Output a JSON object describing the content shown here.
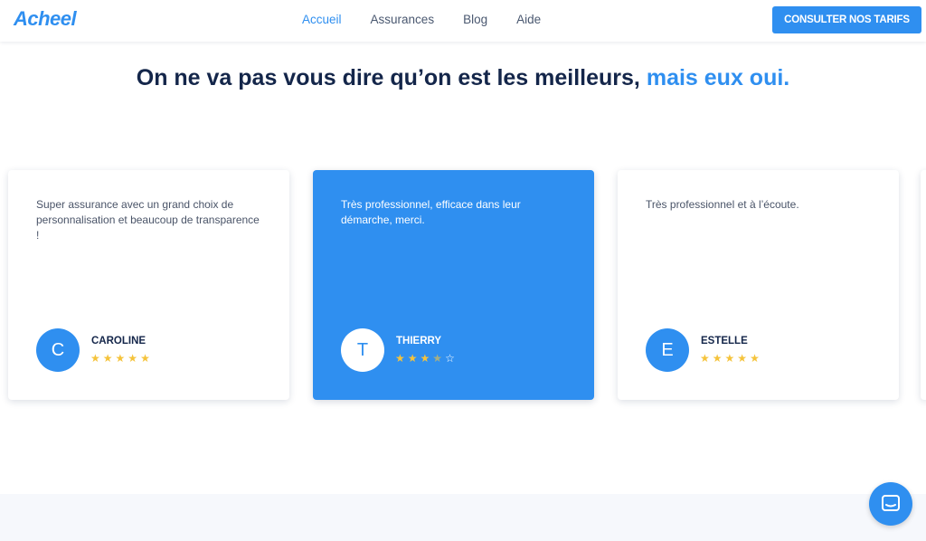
{
  "nav": {
    "logo": "Acheel",
    "links": [
      "Accueil",
      "Assurances",
      "Blog",
      "Aide"
    ],
    "cta": "CONSULTER NOS TARIFS"
  },
  "headline": {
    "part1": "On ne va pas vous dire qu’on est les meilleurs,",
    "part2": "mais eux oui."
  },
  "reviews": [
    {
      "quote": "Super assurance avec un grand choix de personnalisation et beaucoup de transparence !",
      "initial": "C",
      "name": "CAROLINE",
      "rating": 5
    },
    {
      "quote": "Très professionnel, efficace dans leur démarche, merci.",
      "initial": "T",
      "name": "THIERRY",
      "rating": 3.5
    },
    {
      "quote": "Très professionnel et à l’écoute.",
      "initial": "E",
      "name": "ESTELLE",
      "rating": 5
    }
  ],
  "colors": {
    "accent": "#2f8ff0",
    "dark": "#14264a",
    "star": "#f5c33b"
  },
  "icons": {
    "chat": "chat-bubble-icon"
  }
}
